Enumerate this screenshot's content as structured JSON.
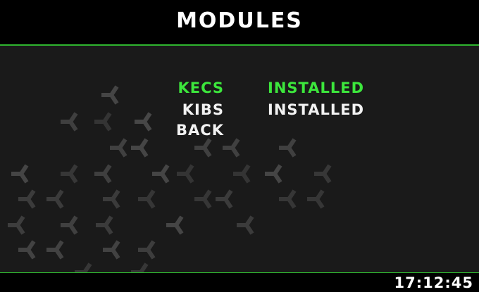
{
  "screen": {
    "title": "MODULES"
  },
  "modules": [
    {
      "name": "KECS",
      "status": "INSTALLED",
      "selected": true
    },
    {
      "name": "KIBS",
      "status": "INSTALLED",
      "selected": false
    }
  ],
  "back_label": "BACK",
  "clock": "17:12:45",
  "colors": {
    "accent": "#2fb52f",
    "selected_text": "#3ce63c",
    "background": "#1a1a1a"
  },
  "decoration": "hexagon-pattern"
}
